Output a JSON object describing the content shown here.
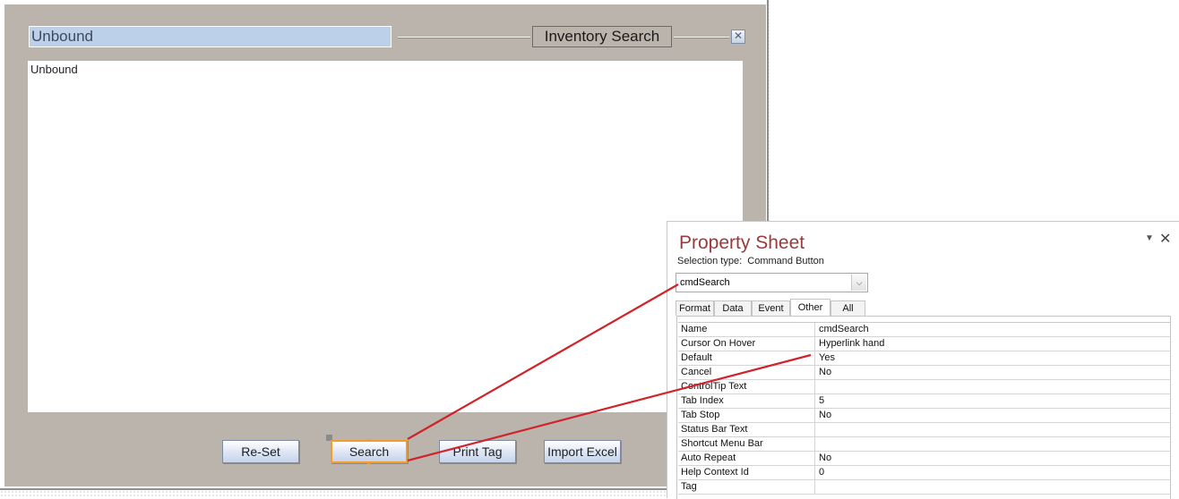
{
  "form": {
    "title_field_value": "Unbound",
    "heading_label": "Inventory Search",
    "close_icon": "close-icon",
    "subform_value": "Unbound",
    "buttons": {
      "reset": "Re-Set",
      "search": "Search",
      "print_tag": "Print Tag",
      "import_excel": "Import Excel"
    }
  },
  "property_sheet": {
    "title": "Property Sheet",
    "selection_type_label": "Selection type:",
    "selection_type_value": "Command Button",
    "object_selector_value": "cmdSearch",
    "tabs": [
      {
        "label": "Format"
      },
      {
        "label": "Data"
      },
      {
        "label": "Event"
      },
      {
        "label": "Other"
      },
      {
        "label": "All"
      }
    ],
    "active_tab": "Other",
    "rows": [
      {
        "name": "Name",
        "value": "cmdSearch"
      },
      {
        "name": "Cursor On Hover",
        "value": "Hyperlink hand"
      },
      {
        "name": "Default",
        "value": "Yes"
      },
      {
        "name": "Cancel",
        "value": "No"
      },
      {
        "name": "ControlTip Text",
        "value": ""
      },
      {
        "name": "Tab Index",
        "value": "5"
      },
      {
        "name": "Tab Stop",
        "value": "No"
      },
      {
        "name": "Status Bar Text",
        "value": ""
      },
      {
        "name": "Shortcut Menu Bar",
        "value": ""
      },
      {
        "name": "Auto Repeat",
        "value": "No"
      },
      {
        "name": "Help Context Id",
        "value": "0"
      },
      {
        "name": "Tag",
        "value": ""
      }
    ]
  },
  "colors": {
    "form_background": "#bab4ac",
    "title_field_background": "#bcd0ea",
    "property_sheet_title": "#9b3a3a",
    "selected_outline": "#f39c2b",
    "annotation_arrow": "#d0232a"
  }
}
